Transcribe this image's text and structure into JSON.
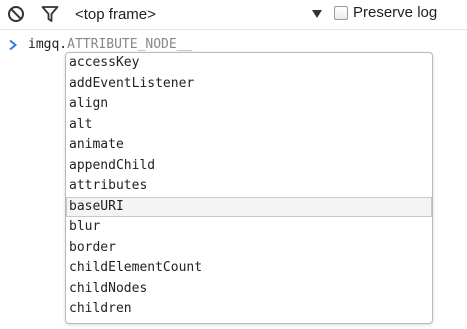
{
  "toolbar": {
    "clear_icon": "clear-console-icon",
    "filter_icon": "filter-icon",
    "frame_select": "<top frame>",
    "preserve_log": {
      "label": "Preserve log",
      "checked": false
    }
  },
  "console": {
    "prompt_icon": "prompt-chevron-icon",
    "typed_text": "imgq.",
    "suggestion_text": "ATTRIBUTE_NODE__"
  },
  "autocomplete": {
    "selected_item": "baseURI",
    "items": [
      "accessKey",
      "addEventListener",
      "align",
      "alt",
      "animate",
      "appendChild",
      "attributes",
      "baseURI",
      "blur",
      "border",
      "childElementCount",
      "childNodes",
      "children"
    ]
  },
  "colors": {
    "accent_prompt": "#2a7ee6",
    "icon_gray": "#333333",
    "suggestion_gray": "#888888",
    "selection_border": "#c8c8c8"
  }
}
